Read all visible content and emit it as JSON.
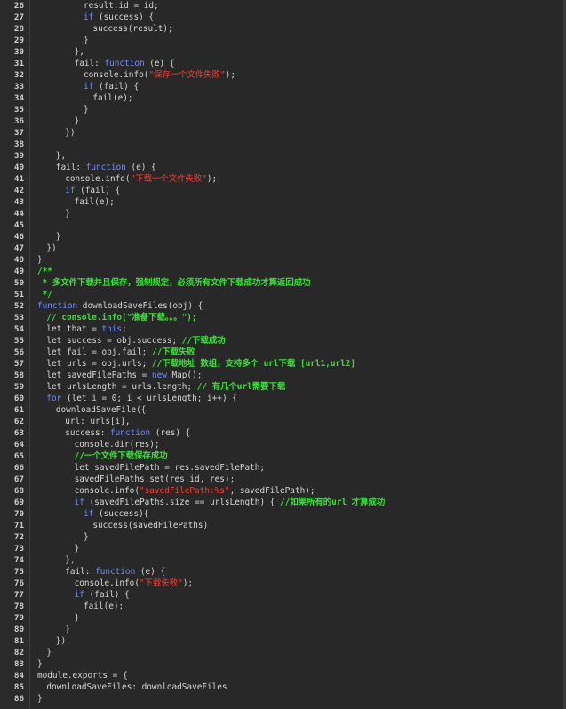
{
  "editor": {
    "lines": [
      {
        "n": "26",
        "indent": 10,
        "parts": [
          {
            "t": "result.id = id;",
            "c": "txt"
          }
        ]
      },
      {
        "n": "27",
        "indent": 10,
        "parts": [
          {
            "t": "if",
            "c": "kw"
          },
          {
            "t": " (success) {",
            "c": "txt"
          }
        ]
      },
      {
        "n": "28",
        "indent": 12,
        "parts": [
          {
            "t": "success(result);",
            "c": "txt"
          }
        ]
      },
      {
        "n": "29",
        "indent": 10,
        "parts": [
          {
            "t": "}",
            "c": "txt"
          }
        ]
      },
      {
        "n": "30",
        "indent": 8,
        "parts": [
          {
            "t": "},",
            "c": "txt"
          }
        ]
      },
      {
        "n": "31",
        "indent": 8,
        "parts": [
          {
            "t": "fail: ",
            "c": "txt"
          },
          {
            "t": "function",
            "c": "kw"
          },
          {
            "t": " (e) {",
            "c": "txt"
          }
        ]
      },
      {
        "n": "32",
        "indent": 10,
        "parts": [
          {
            "t": "console.info(",
            "c": "txt"
          },
          {
            "t": "\"保存一个文件失败\"",
            "c": "str"
          },
          {
            "t": ");",
            "c": "txt"
          }
        ]
      },
      {
        "n": "33",
        "indent": 10,
        "parts": [
          {
            "t": "if",
            "c": "kw"
          },
          {
            "t": " (fail) {",
            "c": "txt"
          }
        ]
      },
      {
        "n": "34",
        "indent": 12,
        "parts": [
          {
            "t": "fail(e);",
            "c": "txt"
          }
        ]
      },
      {
        "n": "35",
        "indent": 10,
        "parts": [
          {
            "t": "}",
            "c": "txt"
          }
        ]
      },
      {
        "n": "36",
        "indent": 8,
        "parts": [
          {
            "t": "}",
            "c": "txt"
          }
        ]
      },
      {
        "n": "37",
        "indent": 6,
        "parts": [
          {
            "t": "})",
            "c": "txt"
          }
        ]
      },
      {
        "n": "38",
        "indent": 0,
        "parts": []
      },
      {
        "n": "39",
        "indent": 4,
        "parts": [
          {
            "t": "},",
            "c": "txt"
          }
        ]
      },
      {
        "n": "40",
        "indent": 4,
        "parts": [
          {
            "t": "fail: ",
            "c": "txt"
          },
          {
            "t": "function",
            "c": "kw"
          },
          {
            "t": " (e) {",
            "c": "txt"
          }
        ]
      },
      {
        "n": "41",
        "indent": 6,
        "parts": [
          {
            "t": "console.info(",
            "c": "txt"
          },
          {
            "t": "\"下载一个文件失败\"",
            "c": "str"
          },
          {
            "t": ");",
            "c": "txt"
          }
        ]
      },
      {
        "n": "42",
        "indent": 6,
        "parts": [
          {
            "t": "if",
            "c": "kw"
          },
          {
            "t": " (fail) {",
            "c": "txt"
          }
        ]
      },
      {
        "n": "43",
        "indent": 8,
        "parts": [
          {
            "t": "fail(e);",
            "c": "txt"
          }
        ]
      },
      {
        "n": "44",
        "indent": 6,
        "parts": [
          {
            "t": "}",
            "c": "txt"
          }
        ]
      },
      {
        "n": "45",
        "indent": 0,
        "parts": []
      },
      {
        "n": "46",
        "indent": 4,
        "parts": [
          {
            "t": "}",
            "c": "txt"
          }
        ]
      },
      {
        "n": "47",
        "indent": 2,
        "parts": [
          {
            "t": "})",
            "c": "txt"
          }
        ]
      },
      {
        "n": "48",
        "indent": 0,
        "parts": [
          {
            "t": "}",
            "c": "txt"
          }
        ]
      },
      {
        "n": "49",
        "indent": 0,
        "parts": [
          {
            "t": "/**",
            "c": "cmt"
          }
        ]
      },
      {
        "n": "50",
        "indent": 0,
        "parts": [
          {
            "t": " * 多文件下载并且保存，强制规定，必须所有文件下载成功才算返回成功",
            "c": "cmt"
          }
        ]
      },
      {
        "n": "51",
        "indent": 0,
        "parts": [
          {
            "t": " */",
            "c": "cmt"
          }
        ]
      },
      {
        "n": "52",
        "indent": 0,
        "parts": [
          {
            "t": "function",
            "c": "kw"
          },
          {
            "t": " downloadSaveFiles(obj) {",
            "c": "txt"
          }
        ]
      },
      {
        "n": "53",
        "indent": 2,
        "parts": [
          {
            "t": "// console.info(\"准备下载。。。\");",
            "c": "cmt"
          }
        ]
      },
      {
        "n": "54",
        "indent": 2,
        "parts": [
          {
            "t": "let that = ",
            "c": "txt"
          },
          {
            "t": "this",
            "c": "kw"
          },
          {
            "t": ";",
            "c": "txt"
          }
        ]
      },
      {
        "n": "55",
        "indent": 2,
        "parts": [
          {
            "t": "let success = obj.success; ",
            "c": "txt"
          },
          {
            "t": "//下载成功",
            "c": "cmt"
          }
        ]
      },
      {
        "n": "56",
        "indent": 2,
        "parts": [
          {
            "t": "let fail = obj.fail; ",
            "c": "txt"
          },
          {
            "t": "//下载失败",
            "c": "cmt"
          }
        ]
      },
      {
        "n": "57",
        "indent": 2,
        "parts": [
          {
            "t": "let urls = obj.urls; ",
            "c": "txt"
          },
          {
            "t": "//下载地址 数组，支持多个 url下载 [url1,url2]",
            "c": "cmt"
          }
        ]
      },
      {
        "n": "58",
        "indent": 2,
        "parts": [
          {
            "t": "let savedFilePaths = ",
            "c": "txt"
          },
          {
            "t": "new",
            "c": "kw"
          },
          {
            "t": " Map();",
            "c": "txt"
          }
        ]
      },
      {
        "n": "59",
        "indent": 2,
        "parts": [
          {
            "t": "let urlsLength = urls.length; ",
            "c": "txt"
          },
          {
            "t": "// 有几个url需要下载",
            "c": "cmt"
          }
        ]
      },
      {
        "n": "60",
        "indent": 2,
        "parts": [
          {
            "t": "for",
            "c": "kw"
          },
          {
            "t": " (let i = 0; i < urlsLength; i++) {",
            "c": "txt"
          }
        ]
      },
      {
        "n": "61",
        "indent": 4,
        "parts": [
          {
            "t": "downloadSaveFile({",
            "c": "txt"
          }
        ]
      },
      {
        "n": "62",
        "indent": 6,
        "parts": [
          {
            "t": "url: urls[i],",
            "c": "txt"
          }
        ]
      },
      {
        "n": "63",
        "indent": 6,
        "parts": [
          {
            "t": "success: ",
            "c": "txt"
          },
          {
            "t": "function",
            "c": "kw"
          },
          {
            "t": " (res) {",
            "c": "txt"
          }
        ]
      },
      {
        "n": "64",
        "indent": 8,
        "parts": [
          {
            "t": "console.dir(res);",
            "c": "txt"
          }
        ]
      },
      {
        "n": "65",
        "indent": 8,
        "parts": [
          {
            "t": "//一个文件下载保存成功",
            "c": "cmt"
          }
        ]
      },
      {
        "n": "66",
        "indent": 8,
        "parts": [
          {
            "t": "let savedFilePath = res.savedFilePath;",
            "c": "txt"
          }
        ]
      },
      {
        "n": "67",
        "indent": 8,
        "parts": [
          {
            "t": "savedFilePaths.set(res.id, res);",
            "c": "txt"
          }
        ]
      },
      {
        "n": "68",
        "indent": 8,
        "parts": [
          {
            "t": "console.info(",
            "c": "txt"
          },
          {
            "t": "\"savedFilePath:%s\"",
            "c": "str"
          },
          {
            "t": ", savedFilePath);",
            "c": "txt"
          }
        ]
      },
      {
        "n": "69",
        "indent": 8,
        "parts": [
          {
            "t": "if",
            "c": "kw"
          },
          {
            "t": " (savedFilePaths.size == urlsLength) { ",
            "c": "txt"
          },
          {
            "t": "//如果所有的url 才算成功",
            "c": "cmt"
          }
        ]
      },
      {
        "n": "70",
        "indent": 10,
        "parts": [
          {
            "t": "if",
            "c": "kw"
          },
          {
            "t": " (success){",
            "c": "txt"
          }
        ]
      },
      {
        "n": "71",
        "indent": 12,
        "parts": [
          {
            "t": "success(savedFilePaths)",
            "c": "txt"
          }
        ]
      },
      {
        "n": "72",
        "indent": 10,
        "parts": [
          {
            "t": "}",
            "c": "txt"
          }
        ]
      },
      {
        "n": "73",
        "indent": 8,
        "parts": [
          {
            "t": "}",
            "c": "txt"
          }
        ]
      },
      {
        "n": "74",
        "indent": 6,
        "parts": [
          {
            "t": "},",
            "c": "txt"
          }
        ]
      },
      {
        "n": "75",
        "indent": 6,
        "parts": [
          {
            "t": "fail: ",
            "c": "txt"
          },
          {
            "t": "function",
            "c": "kw"
          },
          {
            "t": " (e) {",
            "c": "txt"
          }
        ]
      },
      {
        "n": "76",
        "indent": 8,
        "parts": [
          {
            "t": "console.info(",
            "c": "txt"
          },
          {
            "t": "\"下载失败\"",
            "c": "str"
          },
          {
            "t": ");",
            "c": "txt"
          }
        ]
      },
      {
        "n": "77",
        "indent": 8,
        "parts": [
          {
            "t": "if",
            "c": "kw"
          },
          {
            "t": " (fail) {",
            "c": "txt"
          }
        ]
      },
      {
        "n": "78",
        "indent": 10,
        "parts": [
          {
            "t": "fail(e);",
            "c": "txt"
          }
        ]
      },
      {
        "n": "79",
        "indent": 8,
        "parts": [
          {
            "t": "}",
            "c": "txt"
          }
        ]
      },
      {
        "n": "80",
        "indent": 6,
        "parts": [
          {
            "t": "}",
            "c": "txt"
          }
        ]
      },
      {
        "n": "81",
        "indent": 4,
        "parts": [
          {
            "t": "})",
            "c": "txt"
          }
        ]
      },
      {
        "n": "82",
        "indent": 2,
        "parts": [
          {
            "t": "}",
            "c": "txt"
          }
        ]
      },
      {
        "n": "83",
        "indent": 0,
        "parts": [
          {
            "t": "}",
            "c": "txt"
          }
        ]
      },
      {
        "n": "84",
        "indent": 0,
        "parts": [
          {
            "t": "module.exports = {",
            "c": "txt"
          }
        ]
      },
      {
        "n": "85",
        "indent": 2,
        "parts": [
          {
            "t": "downloadSaveFiles: downloadSaveFiles",
            "c": "txt"
          }
        ]
      },
      {
        "n": "86",
        "indent": 0,
        "parts": [
          {
            "t": "}",
            "c": "txt"
          }
        ]
      }
    ]
  }
}
